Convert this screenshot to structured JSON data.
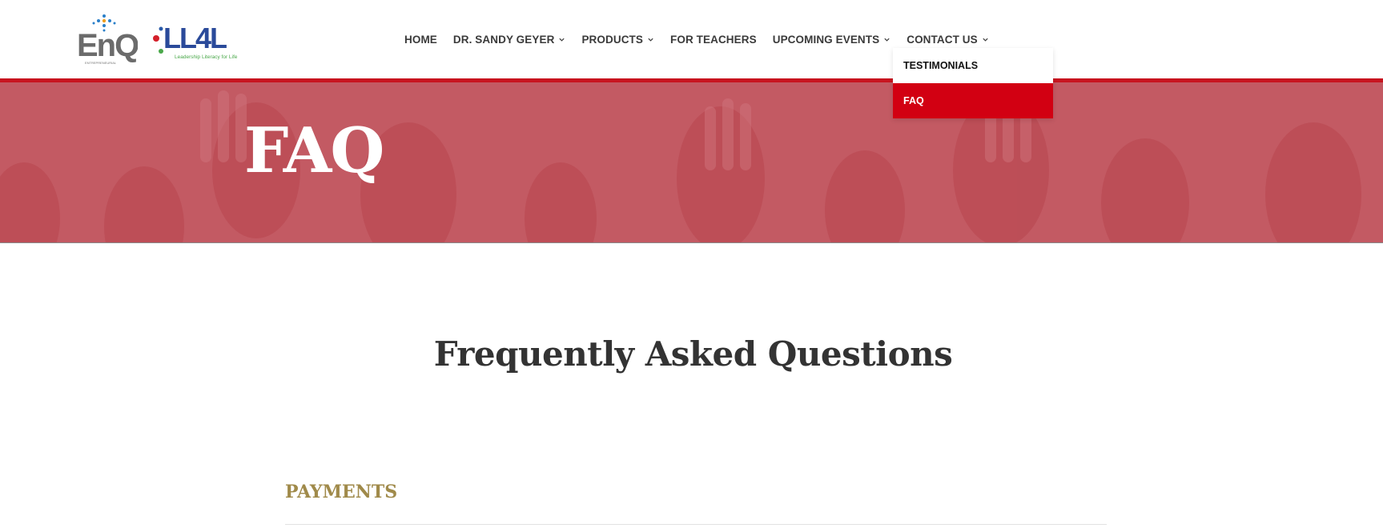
{
  "header": {
    "logo_enq_text": "EnQ",
    "logo_enq_subtitle": "ENTREPRENEURIAL INTELLIGENCE",
    "logo_ll4l_text": "LL4L",
    "logo_ll4l_subtitle": "Leadership Literacy for Life"
  },
  "nav": {
    "items": [
      {
        "label": "HOME",
        "has_dropdown": false
      },
      {
        "label": "DR. SANDY GEYER",
        "has_dropdown": true
      },
      {
        "label": "PRODUCTS",
        "has_dropdown": true
      },
      {
        "label": "FOR TEACHERS",
        "has_dropdown": false
      },
      {
        "label": "UPCOMING EVENTS",
        "has_dropdown": true
      },
      {
        "label": "CONTACT US",
        "has_dropdown": true
      }
    ]
  },
  "dropdown": {
    "items": [
      {
        "label": "TESTIMONIALS",
        "active": false
      },
      {
        "label": "FAQ",
        "active": true
      }
    ]
  },
  "banner": {
    "title": "FAQ"
  },
  "main": {
    "title": "Frequently Asked Questions",
    "section_title": "PAYMENTS"
  },
  "colors": {
    "accent_red": "#d20012",
    "banner_overlay": "#c35a63",
    "section_gold": "#a08a4a",
    "text_dark": "#333333"
  }
}
